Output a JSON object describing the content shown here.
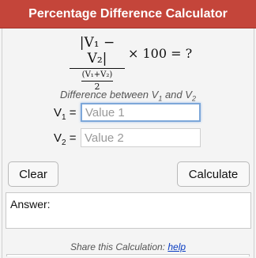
{
  "header": {
    "title": "Percentage Difference Calculator"
  },
  "formula": {
    "numerator": "|V₁ − V₂|",
    "denominator_top": "(V₁+V₂)",
    "denominator_bottom": "2",
    "rest": "× 100 = ?"
  },
  "form": {
    "subtitle_prefix": "Difference between V",
    "subtitle_sub1": "1",
    "subtitle_mid": " and V",
    "subtitle_sub2": "2",
    "v1": {
      "label_base": "V",
      "label_sub": "1",
      "label_eq": " =",
      "placeholder": "Value 1",
      "value": ""
    },
    "v2": {
      "label_base": "V",
      "label_sub": "2",
      "label_eq": " =",
      "placeholder": "Value 2",
      "value": ""
    }
  },
  "buttons": {
    "clear": "Clear",
    "calculate": "Calculate"
  },
  "answer": {
    "label": "Answer:"
  },
  "footer": {
    "share_text": "Share this Calculation: ",
    "help_link": "help"
  }
}
